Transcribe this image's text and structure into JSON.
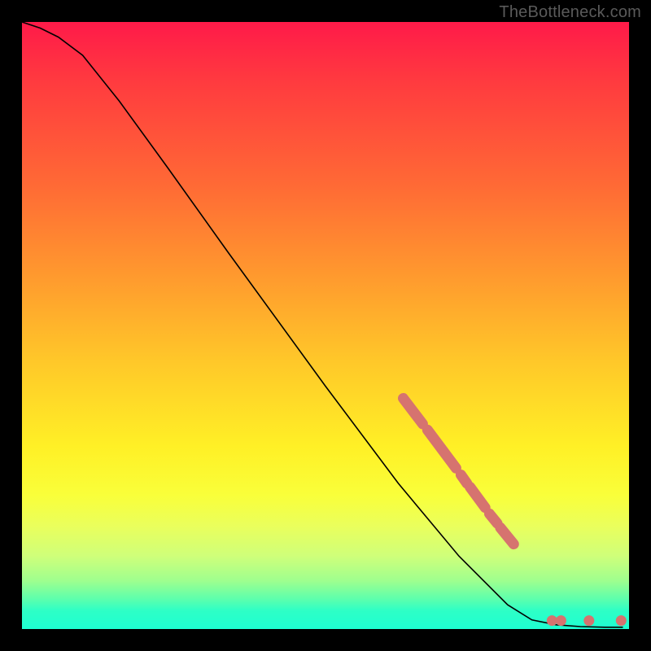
{
  "watermark": "TheBottleneck.com",
  "colors": {
    "curve_stroke": "#000000",
    "marker_fill": "#d6736f",
    "marker_stroke": "#d6736f"
  },
  "chart_data": {
    "type": "line",
    "title": "",
    "xlabel": "",
    "ylabel": "",
    "xlim": [
      0,
      100
    ],
    "ylim": [
      0,
      100
    ],
    "grid": false,
    "series": [
      {
        "name": "curve",
        "points": [
          {
            "x": 0.0,
            "y": 100.0
          },
          {
            "x": 3.0,
            "y": 99.0
          },
          {
            "x": 6.0,
            "y": 97.5
          },
          {
            "x": 10.0,
            "y": 94.5
          },
          {
            "x": 16.0,
            "y": 87.0
          },
          {
            "x": 24.0,
            "y": 76.0
          },
          {
            "x": 34.0,
            "y": 62.0
          },
          {
            "x": 50.0,
            "y": 40.0
          },
          {
            "x": 62.0,
            "y": 24.0
          },
          {
            "x": 72.0,
            "y": 12.0
          },
          {
            "x": 80.0,
            "y": 4.0
          },
          {
            "x": 84.0,
            "y": 1.5
          },
          {
            "x": 88.0,
            "y": 0.7
          },
          {
            "x": 92.0,
            "y": 0.4
          },
          {
            "x": 96.0,
            "y": 0.3
          },
          {
            "x": 99.0,
            "y": 0.3
          }
        ]
      }
    ],
    "markers": {
      "name": "highlight-points",
      "style": "dash-dot",
      "segments": [
        {
          "x1": 62.8,
          "y1": 38.0,
          "x2": 66.0,
          "y2": 33.8
        },
        {
          "x1": 66.8,
          "y1": 32.8,
          "x2": 71.5,
          "y2": 26.5
        },
        {
          "x1": 72.3,
          "y1": 25.4,
          "x2": 73.3,
          "y2": 24.0
        },
        {
          "x1": 73.8,
          "y1": 23.4,
          "x2": 76.3,
          "y2": 20.0
        },
        {
          "x1": 77.0,
          "y1": 19.0,
          "x2": 78.3,
          "y2": 17.4
        },
        {
          "x1": 78.8,
          "y1": 16.7,
          "x2": 81.0,
          "y2": 14.0
        }
      ],
      "dots": [
        {
          "x": 87.3,
          "y": 1.4
        },
        {
          "x": 88.8,
          "y": 1.4
        },
        {
          "x": 93.4,
          "y": 1.4
        },
        {
          "x": 98.7,
          "y": 1.4
        }
      ]
    }
  }
}
